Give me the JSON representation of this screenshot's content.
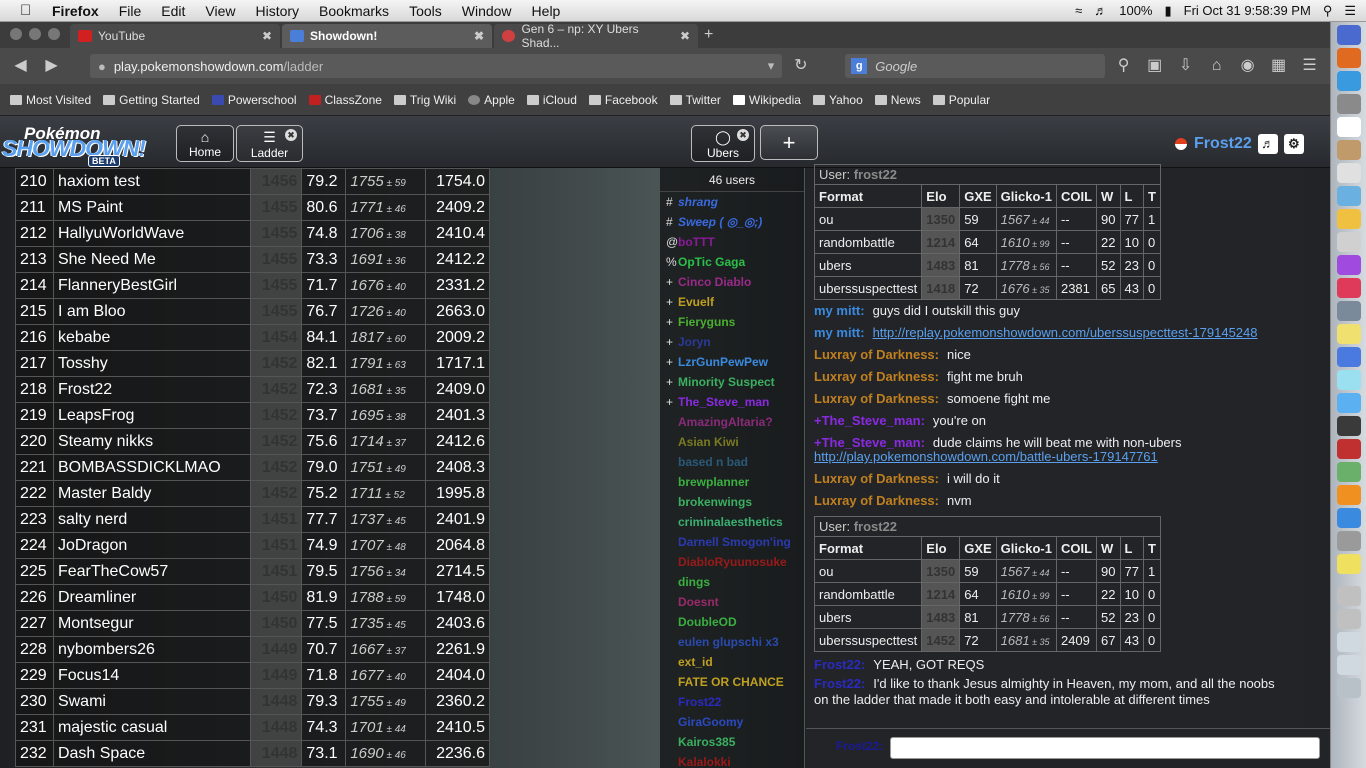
{
  "menubar": {
    "app": "Firefox",
    "items": [
      "File",
      "Edit",
      "View",
      "History",
      "Bookmarks",
      "Tools",
      "Window",
      "Help"
    ],
    "battery": "100%",
    "datetime": "Fri Oct 31  9:58:39 PM"
  },
  "tabs": [
    {
      "label": "YouTube",
      "color": "#d02020"
    },
    {
      "label": "Showdown!",
      "color": "#4a7ed8"
    },
    {
      "label": "Gen 6 – np: XY Ubers Shad...",
      "color": "#d04040"
    }
  ],
  "url": {
    "host": "play.pokemonshowdown.com",
    "path": "/ladder"
  },
  "search": {
    "engine": "Google",
    "placeholder": "Google"
  },
  "bookmarks": [
    "Most Visited",
    "Getting Started",
    "Powerschool",
    "ClassZone",
    "Trig Wiki",
    "Apple",
    "iCloud",
    "Facebook",
    "Twitter",
    "Wikipedia",
    "Yahoo",
    "News",
    "Popular"
  ],
  "ps": {
    "logo_top": "Pokémon",
    "logo_main": "SHOWDOWN!",
    "logo_beta": "BETA",
    "home": "Home",
    "ladder": "Ladder",
    "room": "Ubers",
    "plus": "+",
    "username": "Frost22"
  },
  "ladder_rows": [
    [
      "210",
      "haxiom test",
      "1456",
      "79.2",
      "1755",
      "59",
      "1754.0"
    ],
    [
      "211",
      "MS Paint",
      "1455",
      "80.6",
      "1771",
      "46",
      "2409.2"
    ],
    [
      "212",
      "HallyuWorldWave",
      "1455",
      "74.8",
      "1706",
      "38",
      "2410.4"
    ],
    [
      "213",
      "She Need Me",
      "1455",
      "73.3",
      "1691",
      "36",
      "2412.2"
    ],
    [
      "214",
      "FlanneryBestGirl",
      "1455",
      "71.7",
      "1676",
      "40",
      "2331.2"
    ],
    [
      "215",
      "I am Bloo",
      "1455",
      "76.7",
      "1726",
      "40",
      "2663.0"
    ],
    [
      "216",
      "kebabe",
      "1454",
      "84.1",
      "1817",
      "60",
      "2009.2"
    ],
    [
      "217",
      "Tosshy",
      "1452",
      "82.1",
      "1791",
      "63",
      "1717.1"
    ],
    [
      "218",
      "Frost22",
      "1452",
      "72.3",
      "1681",
      "35",
      "2409.0"
    ],
    [
      "219",
      "LeapsFrog",
      "1452",
      "73.7",
      "1695",
      "38",
      "2401.3"
    ],
    [
      "220",
      "Steamy nikks",
      "1452",
      "75.6",
      "1714",
      "37",
      "2412.6"
    ],
    [
      "221",
      "BOMBASSDICKLMAO",
      "1452",
      "79.0",
      "1751",
      "49",
      "2408.3"
    ],
    [
      "222",
      "Master Baldy",
      "1452",
      "75.2",
      "1711",
      "52",
      "1995.8"
    ],
    [
      "223",
      "salty nerd",
      "1451",
      "77.7",
      "1737",
      "45",
      "2401.9"
    ],
    [
      "224",
      "JoDragon",
      "1451",
      "74.9",
      "1707",
      "48",
      "2064.8"
    ],
    [
      "225",
      "FearTheCow57",
      "1451",
      "79.5",
      "1756",
      "34",
      "2714.5"
    ],
    [
      "226",
      "Dreamliner",
      "1450",
      "81.9",
      "1788",
      "59",
      "1748.0"
    ],
    [
      "227",
      "Montsegur",
      "1450",
      "77.5",
      "1735",
      "45",
      "2403.6"
    ],
    [
      "228",
      "nybombers26",
      "1449",
      "70.7",
      "1667",
      "37",
      "2261.9"
    ],
    [
      "229",
      "Focus14",
      "1449",
      "71.8",
      "1677",
      "40",
      "2404.0"
    ],
    [
      "230",
      "Swami",
      "1448",
      "79.3",
      "1755",
      "49",
      "2360.2"
    ],
    [
      "231",
      "majestic casual",
      "1448",
      "74.3",
      "1701",
      "44",
      "2410.5"
    ],
    [
      "232",
      "Dash Space",
      "1448",
      "73.1",
      "1690",
      "46",
      "2236.6"
    ]
  ],
  "userlist": {
    "count": "46 users",
    "users": [
      {
        "rank": "#",
        "name": "shrang",
        "color": "#3a6ae0",
        "italic": true
      },
      {
        "rank": "#",
        "name": "Sweep ( ◎_◎;)",
        "color": "#3a6ae0",
        "italic": true
      },
      {
        "rank": "@",
        "name": "boTTT",
        "color": "#8a1a9a",
        "italic": false
      },
      {
        "rank": "%",
        "name": "OpTic Gaga",
        "color": "#2ac04a",
        "italic": false
      },
      {
        "rank": "+",
        "name": "Cinco Diablo",
        "color": "#9a2a8a",
        "italic": false
      },
      {
        "rank": "+",
        "name": "Evuelf",
        "color": "#c0a020",
        "italic": false
      },
      {
        "rank": "+",
        "name": "Fieryguns",
        "color": "#4ab030",
        "italic": false
      },
      {
        "rank": "+",
        "name": "Joryn",
        "color": "#2a3a9a",
        "italic": false
      },
      {
        "rank": "+",
        "name": "LzrGunPewPew",
        "color": "#3a8ae0",
        "italic": false
      },
      {
        "rank": "+",
        "name": "Minority Suspect",
        "color": "#3ab060",
        "italic": false
      },
      {
        "rank": "+",
        "name": "The_Steve_man",
        "color": "#8a2ae0",
        "italic": false
      },
      {
        "rank": "",
        "name": "AmazingAltaria?",
        "color": "#8a2a7a",
        "italic": false
      },
      {
        "rank": "",
        "name": "Asian Kiwi",
        "color": "#7a7a20",
        "italic": false
      },
      {
        "rank": "",
        "name": "based n bad",
        "color": "#2a5a7a",
        "italic": false
      },
      {
        "rank": "",
        "name": "brewplanner",
        "color": "#3ab040",
        "italic": false
      },
      {
        "rank": "",
        "name": "brokenwings",
        "color": "#3ab060",
        "italic": false
      },
      {
        "rank": "",
        "name": "criminalaesthetics",
        "color": "#3ab070",
        "italic": false
      },
      {
        "rank": "",
        "name": "Darnell Smogon'ing",
        "color": "#2a3ab0",
        "italic": false
      },
      {
        "rank": "",
        "name": "DiabloRyuunosuke",
        "color": "#9a1a1a",
        "italic": false
      },
      {
        "rank": "",
        "name": "dings",
        "color": "#3ab040",
        "italic": false
      },
      {
        "rank": "",
        "name": "Doesnt",
        "color": "#9a2a6a",
        "italic": false
      },
      {
        "rank": "",
        "name": "DoubleOD",
        "color": "#3ab040",
        "italic": false
      },
      {
        "rank": "",
        "name": "eulen glupschi x3",
        "color": "#2a4ab0",
        "italic": false
      },
      {
        "rank": "",
        "name": "ext_id",
        "color": "#c0a020",
        "italic": false
      },
      {
        "rank": "",
        "name": "FATE OR CHANCE",
        "color": "#c0a020",
        "italic": false
      },
      {
        "rank": "",
        "name": "Frost22",
        "color": "#2a2ac0",
        "italic": false
      },
      {
        "rank": "",
        "name": "GiraGoomy",
        "color": "#2a4ac0",
        "italic": false
      },
      {
        "rank": "",
        "name": "Kairos385",
        "color": "#3ab060",
        "italic": false
      },
      {
        "rank": "",
        "name": "Kalalokki",
        "color": "#9a1a1a",
        "italic": false
      }
    ]
  },
  "rank_table_headers": [
    "Format",
    "Elo",
    "GXE",
    "Glicko-1",
    "COIL",
    "W",
    "L",
    "T"
  ],
  "chat": {
    "rank1": {
      "user_label": "User:",
      "user": "frost22",
      "rows": [
        [
          "ou",
          "1350",
          "59",
          "1567",
          "44",
          "--",
          "90",
          "77",
          "1"
        ],
        [
          "randombattle",
          "1214",
          "64",
          "1610",
          "99",
          "--",
          "22",
          "10",
          "0"
        ],
        [
          "ubers",
          "1483",
          "81",
          "1778",
          "56",
          "--",
          "52",
          "23",
          "0"
        ],
        [
          "uberssuspecttest",
          "1418",
          "72",
          "1676",
          "35",
          "2381",
          "65",
          "43",
          "0"
        ]
      ]
    },
    "lines1": [
      {
        "name": "my mitt:",
        "color": "#3a8ae0",
        "text": "guys did I outskill this guy",
        "link": ""
      },
      {
        "name": "my mitt:",
        "color": "#3a8ae0",
        "text": "",
        "link": "http://replay.pokemonshowdown.com/uberssuspecttest-179145248"
      },
      {
        "name": "Luxray of Darkness:",
        "color": "#c08020",
        "text": "nice",
        "link": ""
      },
      {
        "name": "Luxray of Darkness:",
        "color": "#c08020",
        "text": "fight me bruh",
        "link": ""
      },
      {
        "name": "Luxray of Darkness:",
        "color": "#c08020",
        "text": "somoene fight me",
        "link": ""
      },
      {
        "name": "+The_Steve_man:",
        "color": "#8a2ae0",
        "text": "you're on",
        "link": ""
      },
      {
        "name": "+The_Steve_man:",
        "color": "#8a2ae0",
        "text": "dude claims he will beat me with non-ubers",
        "link": ""
      },
      {
        "name": "",
        "color": "#3a8ae0",
        "text": "",
        "link": "http://play.pokemonshowdown.com/battle-ubers-179147761"
      },
      {
        "name": "Luxray of Darkness:",
        "color": "#c08020",
        "text": "i will do it",
        "link": ""
      },
      {
        "name": "Luxray of Darkness:",
        "color": "#c08020",
        "text": "nvm",
        "link": ""
      }
    ],
    "rank2": {
      "user_label": "User:",
      "user": "frost22",
      "rows": [
        [
          "ou",
          "1350",
          "59",
          "1567",
          "44",
          "--",
          "90",
          "77",
          "1"
        ],
        [
          "randombattle",
          "1214",
          "64",
          "1610",
          "99",
          "--",
          "22",
          "10",
          "0"
        ],
        [
          "ubers",
          "1483",
          "81",
          "1778",
          "56",
          "--",
          "52",
          "23",
          "0"
        ],
        [
          "uberssuspecttest",
          "1452",
          "72",
          "1681",
          "35",
          "2409",
          "67",
          "43",
          "0"
        ]
      ]
    },
    "lines2": [
      {
        "name": "Frost22:",
        "color": "#2a2ac0",
        "text": "YEAH, GOT REQS",
        "link": ""
      },
      {
        "name": "Frost22:",
        "color": "#2a2ac0",
        "text": "I'd like to thank Jesus almighty in Heaven, my mom, and all the noobs",
        "link": ""
      },
      {
        "name": "",
        "color": "#2a2ac0",
        "text": "on the ladder that made it both easy and intolerable at different times",
        "link": ""
      }
    ],
    "input_label": "Frost22:"
  }
}
